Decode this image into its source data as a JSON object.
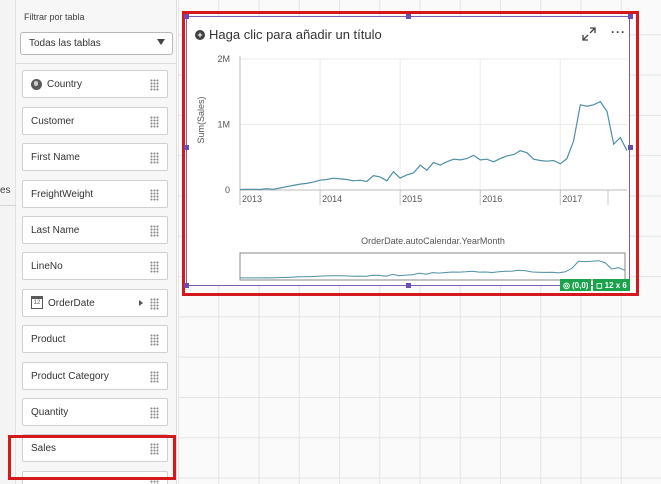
{
  "left_strip": {
    "fragment": "es"
  },
  "panel": {
    "filter_label": "Filtrar por tabla",
    "filter_value": "Todas las tablas",
    "fields": [
      {
        "label": "Country",
        "icon": "globe-icon"
      },
      {
        "label": "Customer",
        "icon": ""
      },
      {
        "label": "First Name",
        "icon": ""
      },
      {
        "label": "FreightWeight",
        "icon": ""
      },
      {
        "label": "Last Name",
        "icon": ""
      },
      {
        "label": "LineNo",
        "icon": ""
      },
      {
        "label": "OrderDate",
        "icon": "calendar-icon"
      },
      {
        "label": "Product",
        "icon": ""
      },
      {
        "label": "Product Category",
        "icon": ""
      },
      {
        "label": "Quantity",
        "icon": ""
      },
      {
        "label": "Sales",
        "icon": ""
      }
    ]
  },
  "chart_object": {
    "title_placeholder": "Haga clic para añadir un título",
    "position_tag": "(0,0)",
    "size_tag": "12 x 6"
  },
  "chart_data": {
    "type": "line",
    "ylabel": "Sum(Sales)",
    "xlabel": "OrderDate.autoCalendar.YearMonth",
    "y_ticks": [
      "0",
      "1M",
      "2M"
    ],
    "x_ticks": [
      "2013",
      "2014",
      "2015",
      "2016",
      "2017"
    ],
    "ylim": [
      0,
      2000000
    ],
    "line_color": "#4e8fa4",
    "series": [
      {
        "values": [
          8000,
          9000,
          10000,
          8000,
          20000,
          10000,
          30000,
          50000,
          70000,
          90000,
          100000,
          120000,
          150000,
          160000,
          180000,
          170000,
          160000,
          140000,
          150000,
          130000,
          220000,
          200000,
          140000,
          280000,
          180000,
          230000,
          260000,
          380000,
          300000,
          420000,
          380000,
          430000,
          470000,
          460000,
          480000,
          530000,
          460000,
          470000,
          430000,
          480000,
          520000,
          540000,
          600000,
          570000,
          470000,
          450000,
          440000,
          450000,
          400000,
          480000,
          750000,
          1300000,
          1280000,
          1300000,
          1350000,
          1200000,
          700000,
          800000,
          600000
        ]
      }
    ]
  }
}
